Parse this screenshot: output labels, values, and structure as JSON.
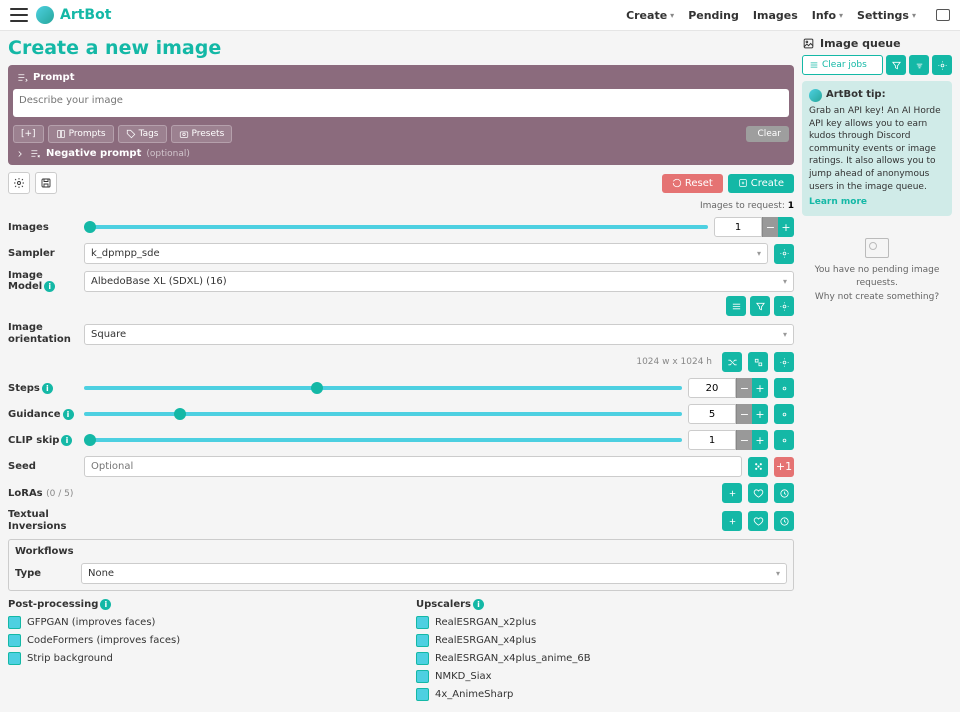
{
  "brand": "ArtBot",
  "nav": {
    "create": "Create",
    "pending": "Pending",
    "images": "Images",
    "info": "Info",
    "settings": "Settings"
  },
  "page_title": "Create a new image",
  "prompt": {
    "label": "Prompt",
    "placeholder": "Describe your image",
    "btn_expand": "[+]",
    "btn_prompts": "Prompts",
    "btn_tags": "Tags",
    "btn_presets": "Presets",
    "btn_clear": "Clear",
    "neg_label": "Negative prompt",
    "neg_optional": "(optional)"
  },
  "actions": {
    "reset": "Reset",
    "create": "Create",
    "req_label": "Images to request:",
    "req_count": "1"
  },
  "fields": {
    "images": {
      "label": "Images",
      "value": "1"
    },
    "sampler": {
      "label": "Sampler",
      "value": "k_dpmpp_sde"
    },
    "model": {
      "label": "Image Model",
      "value": "AlbedoBase XL (SDXL) (16)"
    },
    "orientation": {
      "label": "Image orientation",
      "value": "Square",
      "dims": "1024 w x 1024 h"
    },
    "steps": {
      "label": "Steps",
      "value": "20"
    },
    "guidance": {
      "label": "Guidance",
      "value": "5"
    },
    "clip": {
      "label": "CLIP skip",
      "value": "1"
    },
    "seed": {
      "label": "Seed",
      "placeholder": "Optional",
      "btn": "+1"
    },
    "loras": {
      "label": "LoRAs",
      "count": "(0 / 5)"
    },
    "ti": {
      "label": "Textual Inversions"
    },
    "workflows": {
      "label": "Workflows",
      "type_label": "Type",
      "type_value": "None"
    }
  },
  "pp": {
    "hdr": "Post-processing",
    "items": [
      "GFPGAN (improves faces)",
      "CodeFormers (improves faces)",
      "Strip background"
    ]
  },
  "up": {
    "hdr": "Upscalers",
    "items": [
      "RealESRGAN_x2plus",
      "RealESRGAN_x4plus",
      "RealESRGAN_x4plus_anime_6B",
      "NMKD_Siax",
      "4x_AnimeSharp"
    ]
  },
  "queue": {
    "hdr": "Image queue",
    "clear": "Clear jobs",
    "tip_hdr": "ArtBot tip:",
    "tip_body": "Grab an API key! An AI Horde API key allows you to earn kudos through Discord community events or image ratings. It also allows you to jump ahead of anonymous users in the image queue.",
    "learn": "Learn more",
    "empty1": "You have no pending image requests.",
    "empty2": "Why not create something?"
  }
}
